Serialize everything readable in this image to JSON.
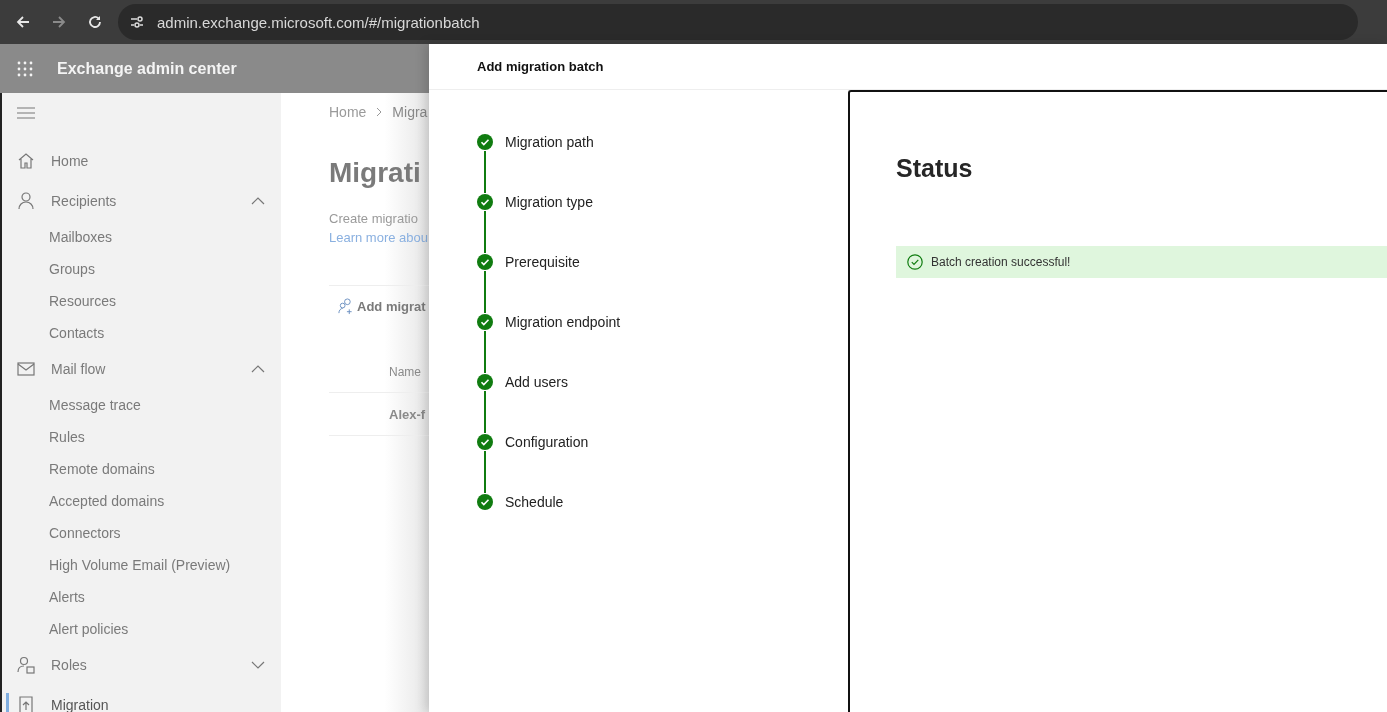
{
  "browser": {
    "url": "admin.exchange.microsoft.com/#/migrationbatch",
    "forward_disabled": true
  },
  "app_header": {
    "title": "Exchange admin center"
  },
  "sidebar": {
    "items": [
      {
        "label": "Home",
        "selected": false
      },
      {
        "label": "Recipients",
        "selected": false,
        "expanded": true,
        "children": [
          {
            "label": "Mailboxes",
            "selected": false
          },
          {
            "label": "Groups",
            "selected": false
          },
          {
            "label": "Resources",
            "selected": false
          },
          {
            "label": "Contacts",
            "selected": false
          }
        ]
      },
      {
        "label": "Mail flow",
        "selected": false,
        "expanded": true,
        "children": [
          {
            "label": "Message trace",
            "selected": false
          },
          {
            "label": "Rules",
            "selected": false
          },
          {
            "label": "Remote domains",
            "selected": false
          },
          {
            "label": "Accepted domains",
            "selected": false
          },
          {
            "label": "Connectors",
            "selected": false
          },
          {
            "label": "High Volume Email (Preview)",
            "selected": false
          },
          {
            "label": "Alerts",
            "selected": false
          },
          {
            "label": "Alert policies",
            "selected": false
          }
        ]
      },
      {
        "label": "Roles",
        "selected": false,
        "expanded": false
      },
      {
        "label": "Migration",
        "selected": true
      }
    ]
  },
  "background_page": {
    "breadcrumb": [
      "Home",
      "Migra"
    ],
    "title": "Migrati",
    "description": "Create migratio",
    "link": "Learn more abou",
    "toolbar_button": "Add migrat",
    "table": {
      "columns": [
        "Name"
      ],
      "rows": [
        [
          "Alex-f"
        ]
      ]
    }
  },
  "panel": {
    "title": "Add migration batch",
    "steps": [
      {
        "label": "Migration path",
        "completed": true
      },
      {
        "label": "Migration type",
        "completed": true
      },
      {
        "label": "Prerequisite",
        "completed": true
      },
      {
        "label": "Migration endpoint",
        "completed": true
      },
      {
        "label": "Add users",
        "completed": true
      },
      {
        "label": "Configuration",
        "completed": true
      },
      {
        "label": "Schedule",
        "completed": true
      }
    ],
    "heading": "Status",
    "message": {
      "kind": "success",
      "text": "Batch creation successful!"
    }
  }
}
